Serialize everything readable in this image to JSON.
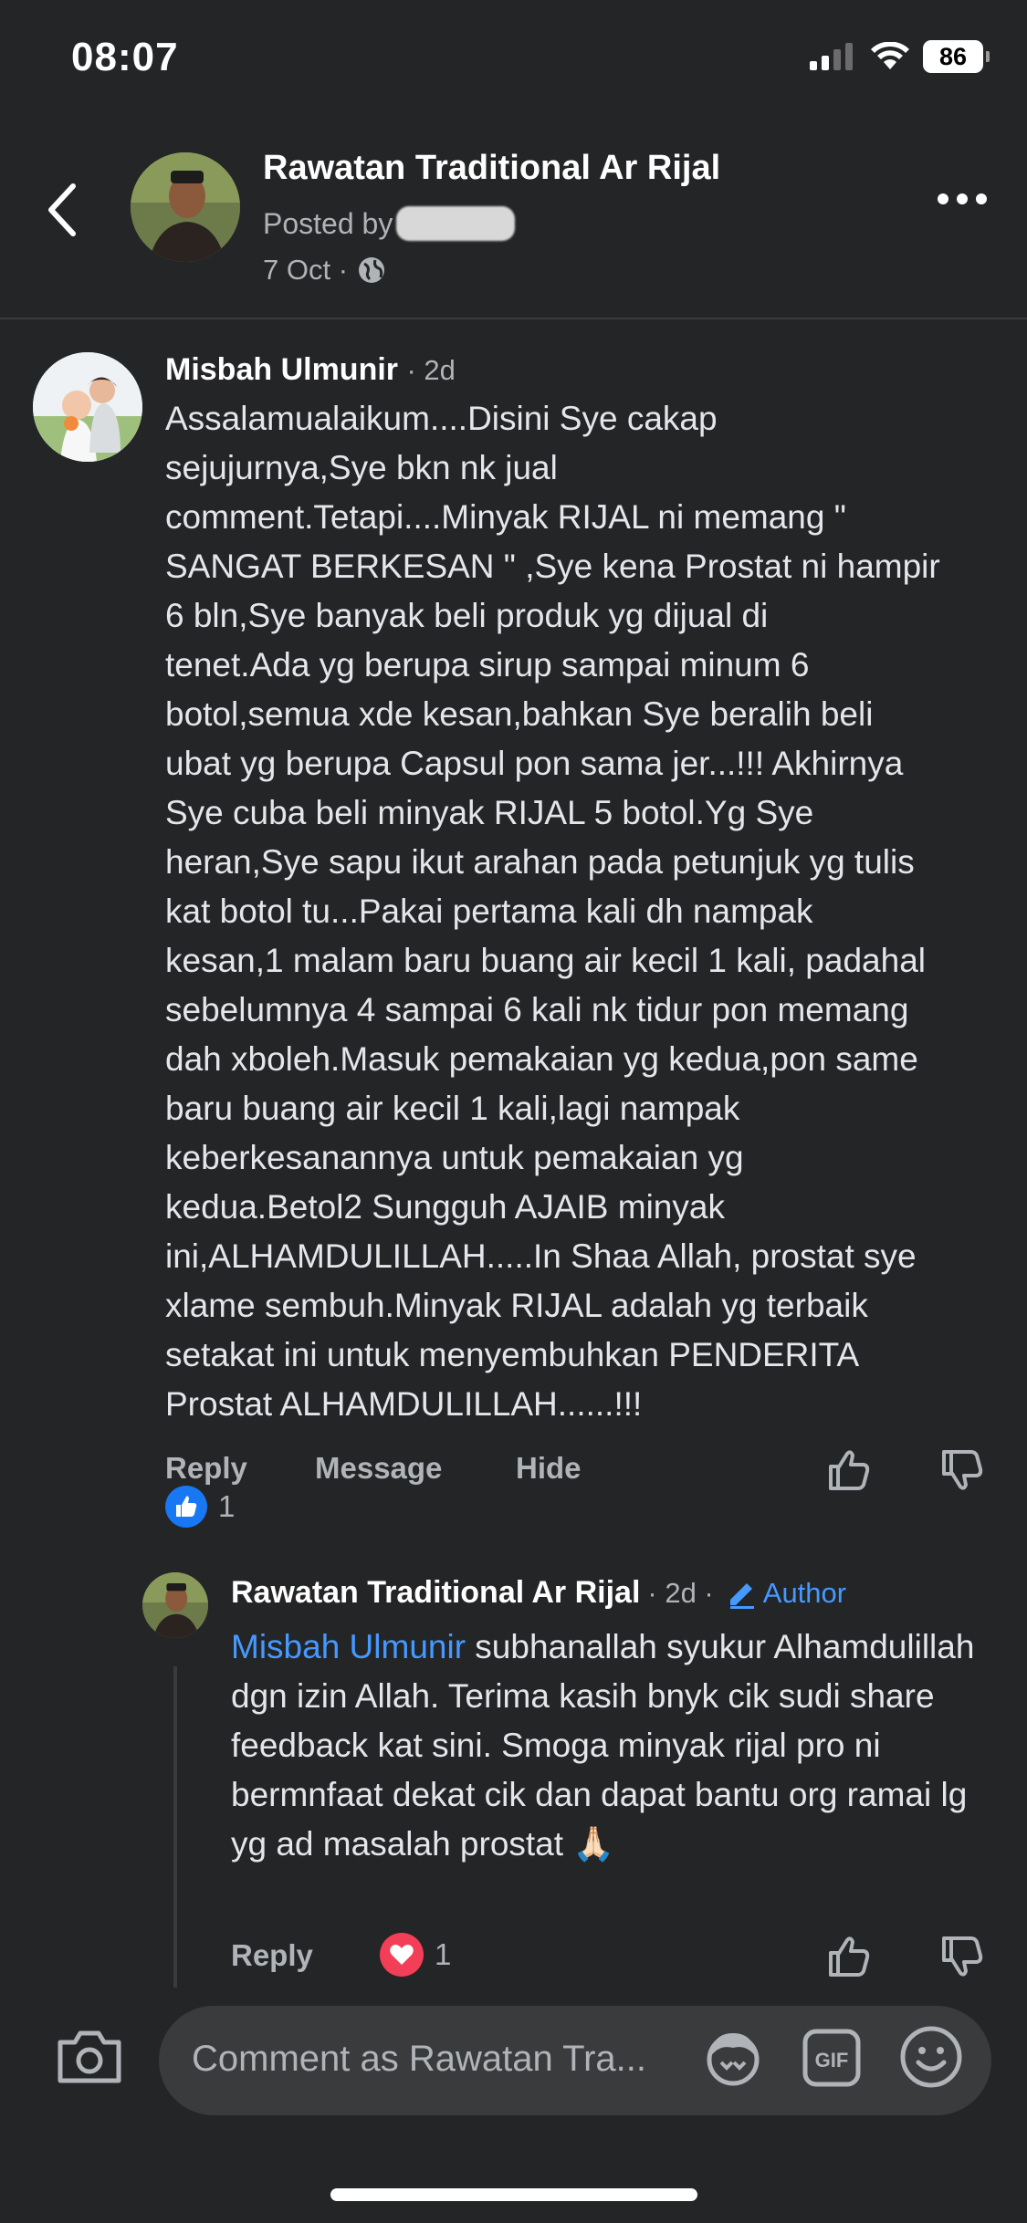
{
  "status_bar": {
    "time": "08:07",
    "battery": "86"
  },
  "header": {
    "page_name": "Rawatan Traditional Ar Rijal",
    "posted_by_label": "Posted by",
    "date": "7 Oct ·"
  },
  "comment": {
    "author": "Misbah Ulmunir",
    "time": "· 2d",
    "text": "Assalamualaikum....Disini Sye cakap\nsejujurnya,Sye bkn nk jual\ncomment.Tetapi....Minyak RIJAL ni memang \"\nSANGAT BERKESAN \" ,Sye kena Prostat ni hampir\n6 bln,Sye banyak beli produk yg dijual di\ntenet.Ada yg berupa sirup sampai minum 6\nbotol,semua xde kesan,bahkan Sye beralih beli\nubat yg berupa Capsul pon sama jer...!!! Akhirnya\nSye cuba beli minyak RIJAL 5 botol.Yg Sye\nheran,Sye sapu ikut arahan pada petunjuk yg tulis\nkat botol tu...Pakai pertama kali dh nampak\nkesan,1 malam baru buang air kecil 1 kali, padahal\nsebelumnya 4 sampai 6 kali nk tidur pon memang\ndah xboleh.Masuk pemakaian yg kedua,pon same\nbaru buang air kecil 1 kali,lagi nampak\nkeberkesanannya untuk pemakaian yg\nkedua.Betol2 Sungguh AJAIB minyak\nini,ALHAMDULILLAH.....In Shaa Allah, prostat sye\nxlame sembuh.Minyak RIJAL adalah yg terbaik\nsetakat ini untuk menyembuhkan PENDERITA\nProstat ALHAMDULILLAH......!!!",
    "actions": {
      "reply": "Reply",
      "message": "Message",
      "hide": "Hide"
    },
    "reaction_count": "1"
  },
  "reply": {
    "author": "Rawatan Traditional Ar Rijal",
    "time": "· 2d ·",
    "badge": "Author",
    "mention": "Misbah Ulmunir",
    "text": " subhanallah syukur Alhamdulillah dgn izin Allah. Terima kasih bnyk cik sudi share feedback kat sini. Smoga minyak rijal pro ni bermnfaat dekat cik dan dapat bantu org ramai lg yg ad masalah prostat 🙏🏻",
    "reply_label": "Reply",
    "reaction_count": "1"
  },
  "composer": {
    "placeholder": "Comment as Rawatan Tra..."
  },
  "colors": {
    "background": "#242526",
    "accent": "#4599ff",
    "like_blue": "#1877f2",
    "heart_red": "#f33e58"
  }
}
